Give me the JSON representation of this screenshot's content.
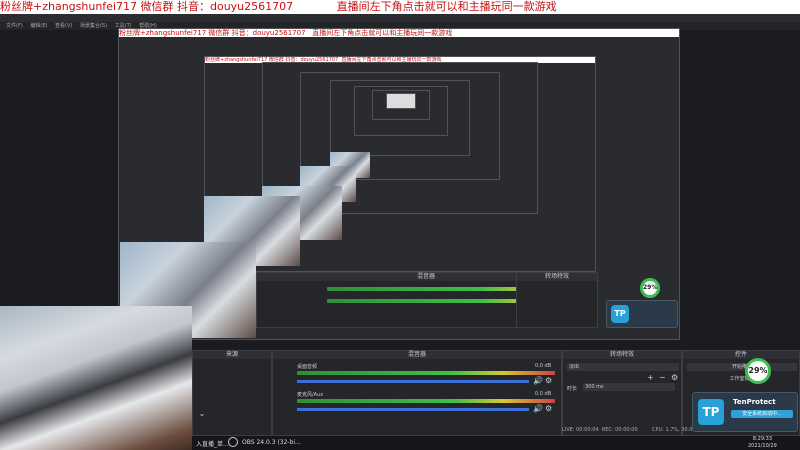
{
  "banner": {
    "fan": "粉丝牌+zhangshunfei717 微信群  抖音：douyu2561707",
    "hint": "直播间左下角点击就可以和主播玩同一款游戏"
  },
  "menu": [
    "文件(F)",
    "编辑(E)",
    "查看(V)",
    "场景集合(S)",
    "工具(T)",
    "帮助(H)"
  ],
  "panels": {
    "scenes_title": "来源",
    "mixer_title": "混音器",
    "transition_title": "转场特效",
    "controls_title": "控件"
  },
  "mixer": {
    "track1_name": "桌面音频",
    "track1_db": "0.0 dB",
    "track2_name": "麦克风/Aux",
    "track2_db": "0.0 dB"
  },
  "transition": {
    "type": "淡出",
    "duration_label": "时长",
    "duration_value": "300 ms"
  },
  "controls": {
    "start_stream": "开始推流",
    "studio_mode": "工作室模式"
  },
  "status": {
    "live": "LIVE: 00:00:04",
    "rec": "REC: 00:00:00",
    "cpu": "CPU: 1.7%, 30.00 fps"
  },
  "taskbar": {
    "app1": "入直播_单...",
    "app2": "OBS 24.0.3 (32-bi...",
    "time": "8:29:33",
    "date": "2021/10/29"
  },
  "tenprotect": {
    "name": "TenProtect",
    "logo": "TP",
    "button": "安全系统启动中..."
  },
  "cpu_circle": "29%",
  "colors": {
    "banner_text": "#c81010",
    "accent_blue": "#3c6fd8",
    "meter_green": "#3fbf4a"
  }
}
